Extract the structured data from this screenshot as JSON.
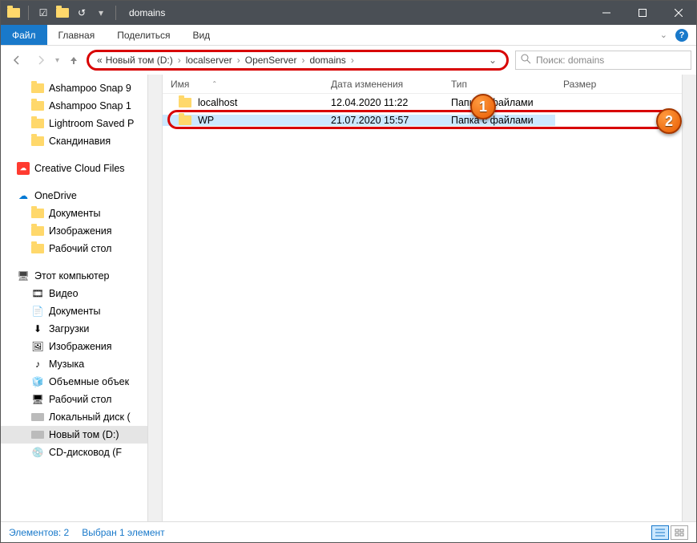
{
  "title": "domains",
  "ribbon": {
    "file": "Файл",
    "tabs": [
      "Главная",
      "Поделиться",
      "Вид"
    ]
  },
  "breadcrumb": {
    "prefix": "«",
    "parts": [
      "Новый том (D:)",
      "localserver",
      "OpenServer",
      "domains"
    ]
  },
  "search": {
    "placeholder": "Поиск: domains"
  },
  "columns": {
    "name": "Имя",
    "date": "Дата изменения",
    "type": "Тип",
    "size": "Размер"
  },
  "items": [
    {
      "name": "localhost",
      "date": "12.04.2020 11:22",
      "type": "Папка с файлами",
      "size": "",
      "selected": false
    },
    {
      "name": "WP",
      "date": "21.07.2020 15:57",
      "type": "Папка с файлами",
      "size": "",
      "selected": true
    }
  ],
  "sidebar": [
    {
      "label": "Ashampoo Snap 9",
      "icon": "folder",
      "indent": 1
    },
    {
      "label": "Ashampoo Snap 1",
      "icon": "folder",
      "indent": 1
    },
    {
      "label": "Lightroom Saved P",
      "icon": "folder",
      "indent": 1
    },
    {
      "label": "Скандинавия",
      "icon": "folder",
      "indent": 1
    },
    {
      "spacer": true
    },
    {
      "label": "Creative Cloud Files",
      "icon": "cc",
      "indent": 0
    },
    {
      "spacer": true
    },
    {
      "label": "OneDrive",
      "icon": "onedrive",
      "indent": 0
    },
    {
      "label": "Документы",
      "icon": "folder",
      "indent": 1
    },
    {
      "label": "Изображения",
      "icon": "folder",
      "indent": 1
    },
    {
      "label": "Рабочий стол",
      "icon": "folder",
      "indent": 1
    },
    {
      "spacer": true
    },
    {
      "label": "Этот компьютер",
      "icon": "pc",
      "indent": 0
    },
    {
      "label": "Видео",
      "icon": "video",
      "indent": 1
    },
    {
      "label": "Документы",
      "icon": "docs",
      "indent": 1
    },
    {
      "label": "Загрузки",
      "icon": "down",
      "indent": 1
    },
    {
      "label": "Изображения",
      "icon": "img",
      "indent": 1
    },
    {
      "label": "Музыка",
      "icon": "music",
      "indent": 1
    },
    {
      "label": "Объемные объек",
      "icon": "cube",
      "indent": 1
    },
    {
      "label": "Рабочий стол",
      "icon": "desk",
      "indent": 1
    },
    {
      "label": "Локальный диск (",
      "icon": "drive",
      "indent": 1
    },
    {
      "label": "Новый том (D:)",
      "icon": "drive",
      "indent": 1,
      "selected": true
    },
    {
      "label": "CD-дисковод (F",
      "icon": "cd",
      "indent": 1
    }
  ],
  "status": {
    "count": "Элементов: 2",
    "selected": "Выбран 1 элемент"
  },
  "badges": {
    "one": "1",
    "two": "2"
  }
}
